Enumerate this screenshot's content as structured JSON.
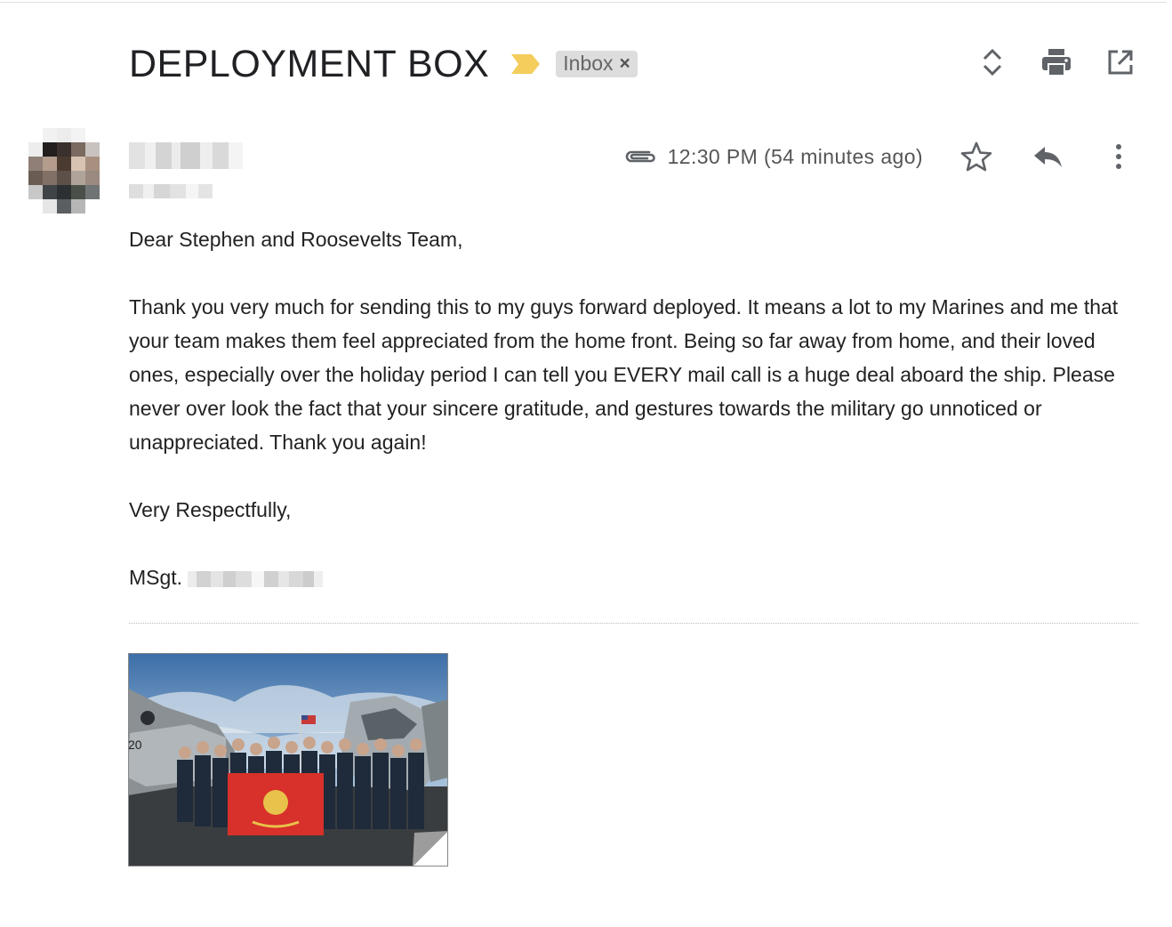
{
  "subject": {
    "title": "DEPLOYMENT BOX",
    "label": "Inbox",
    "label_remove": "×"
  },
  "toolbar": {
    "icons": [
      "expand-collapse-icon",
      "print-icon",
      "open-new-window-icon"
    ]
  },
  "message": {
    "timestamp": "12:30 PM (54 minutes ago)",
    "icons": [
      "paperclip-icon",
      "star-icon",
      "reply-icon",
      "more-vert-icon"
    ],
    "body": {
      "greeting": "Dear Stephen and Roosevelts Team,",
      "paragraph": "Thank you very much for sending this to my guys forward deployed. It means a lot to my Marines and me that your team makes them feel appreciated from the home front.  Being so far away from home,  and their loved ones, especially over the holiday period I can tell you EVERY mail call is a huge deal aboard the ship.  Please never over look the fact that your sincere gratitude, and gestures towards the military go unnoticed or unappreciated. Thank you again!",
      "closing": "Very Respectfully,",
      "signature_prefix": "MSgt."
    },
    "attachment": {
      "type": "image"
    }
  },
  "colors": {
    "importance": "#f4cd5c",
    "chip_bg": "#dddddd",
    "icon": "#5f6368",
    "text": "#222222"
  }
}
